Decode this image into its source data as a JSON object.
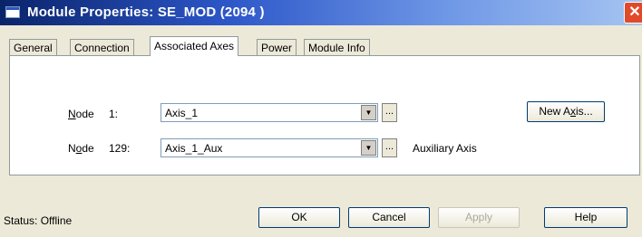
{
  "window": {
    "title": "Module Properties: SE_MOD (2094 )",
    "close_label": "✕"
  },
  "tabs": [
    {
      "label": "General",
      "active": false
    },
    {
      "label": "Connection",
      "active": false
    },
    {
      "label": "Associated Axes",
      "active": true
    },
    {
      "label": "Power",
      "active": false
    },
    {
      "label": "Module Info",
      "active": false
    }
  ],
  "axes": {
    "node1": {
      "prefix": "N",
      "rest": "ode",
      "number": "1:",
      "value": "Axis_1",
      "ellipsis": "..."
    },
    "node129": {
      "prefix": "N",
      "mid": "o",
      "rest": "de",
      "number": "129:",
      "value": "Axis_1_Aux",
      "ellipsis": "...",
      "note": "Auxiliary Axis"
    },
    "new_axis_button": {
      "before": "New A",
      "underline": "x",
      "after": "is..."
    }
  },
  "footer": {
    "status_label": "Status:",
    "status_value": "Offline",
    "ok_label": "OK",
    "cancel_label": "Cancel",
    "apply_label": "Apply",
    "help_label": "Help"
  },
  "colors": {
    "titlebar_start": "#0a246a",
    "close_button": "#e04a2a",
    "dialog_bg": "#ece9d8"
  },
  "icons": {
    "dropdown": "triangle-down",
    "close": "x-mark"
  }
}
